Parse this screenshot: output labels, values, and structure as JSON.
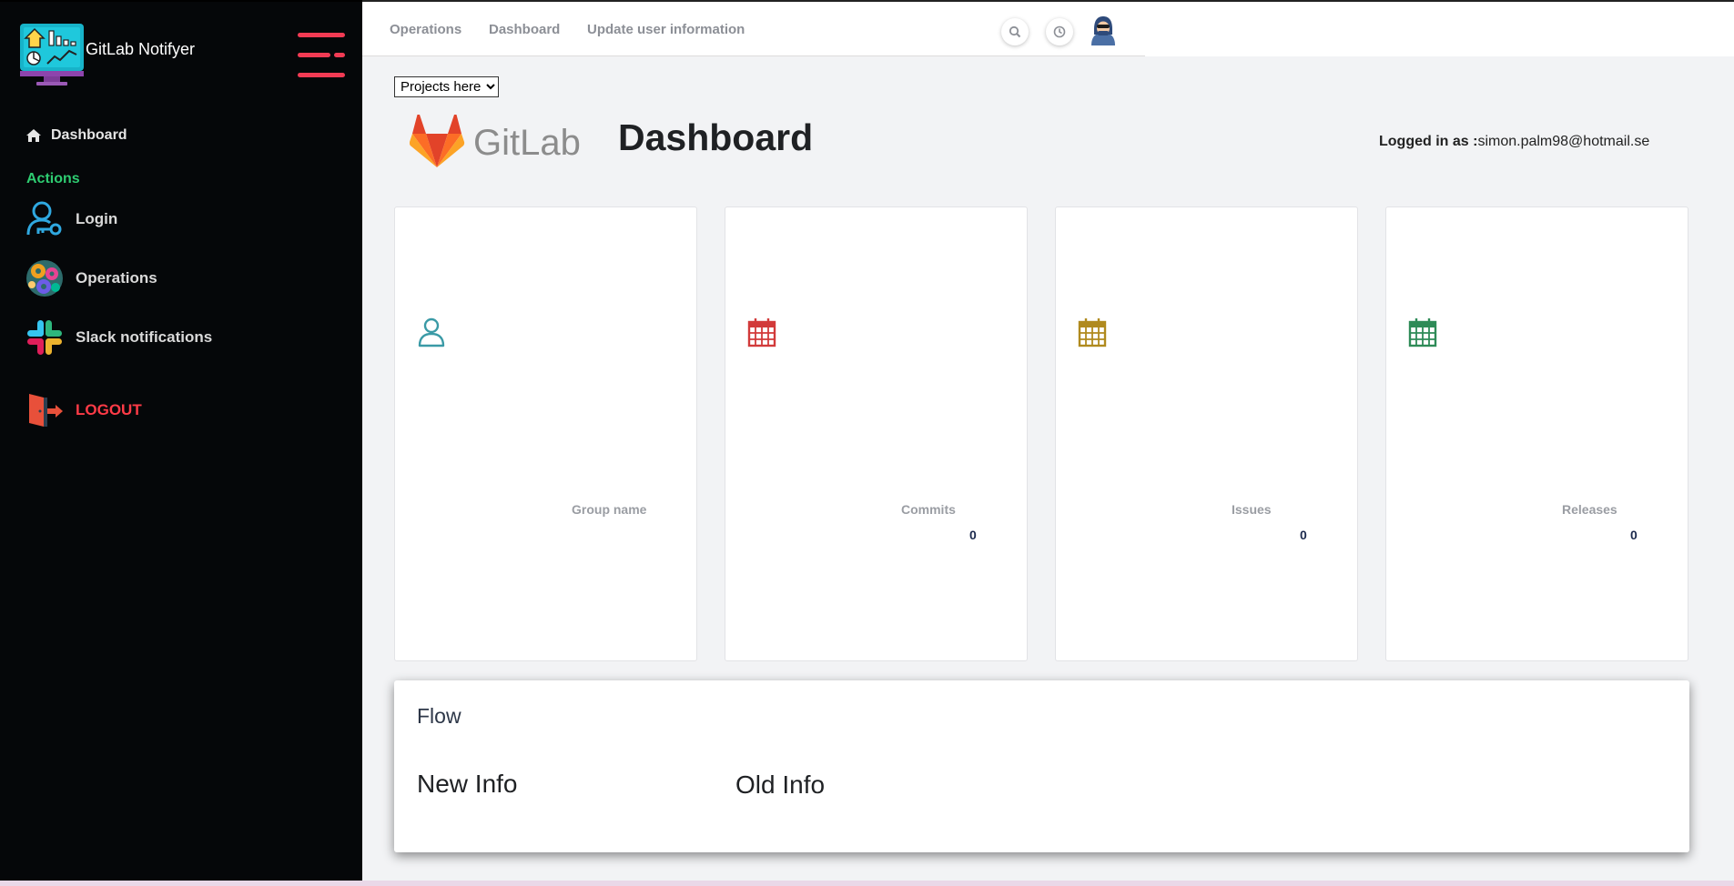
{
  "app": {
    "brand_title": "GitLab Notifyer"
  },
  "sidebar": {
    "dashboard_label": "Dashboard",
    "actions_title": "Actions",
    "items": [
      {
        "label": "Login"
      },
      {
        "label": "Operations"
      },
      {
        "label": "Slack notifications"
      },
      {
        "label": "LOGOUT"
      }
    ]
  },
  "topbar": {
    "links": [
      "Operations",
      "Dashboard",
      "Update user information"
    ]
  },
  "main": {
    "project_select": {
      "selected": "Projects here",
      "options": [
        "Projects here"
      ]
    },
    "logo_text": "GitLab",
    "title": "Dashboard",
    "logged_in_label": "Logged in as :",
    "logged_in_email": "simon.palm98@hotmail.se",
    "cards": [
      {
        "label": "Group name",
        "value": ""
      },
      {
        "label": "Commits",
        "value": "0"
      },
      {
        "label": "Issues",
        "value": "0"
      },
      {
        "label": "Releases",
        "value": "0"
      }
    ],
    "flow": {
      "title": "Flow",
      "new_info": "New Info",
      "old_info": "Old Info"
    }
  },
  "colors": {
    "sidebar_bg": "#050709",
    "accent_red": "#f23b54",
    "actions_green": "#2ecc71",
    "logout_red": "#ff3b47",
    "group_icon": "#3a9aa6",
    "commits_icon": "#d23a3a",
    "issues_icon": "#b08a1e",
    "releases_icon": "#2e8b57"
  },
  "icons": {
    "brand": "monitor-dashboard-icon",
    "hamburger": "hamburger-menu-icon",
    "dashboard": "home-icon",
    "login": "user-key-icon",
    "operations": "gears-icon",
    "slack": "slack-icon",
    "logout": "door-exit-icon",
    "search": "search-icon",
    "history": "clock-icon",
    "avatar": "hacker-avatar-icon",
    "group": "user-outline-icon",
    "calendar": "calendar-icon"
  }
}
